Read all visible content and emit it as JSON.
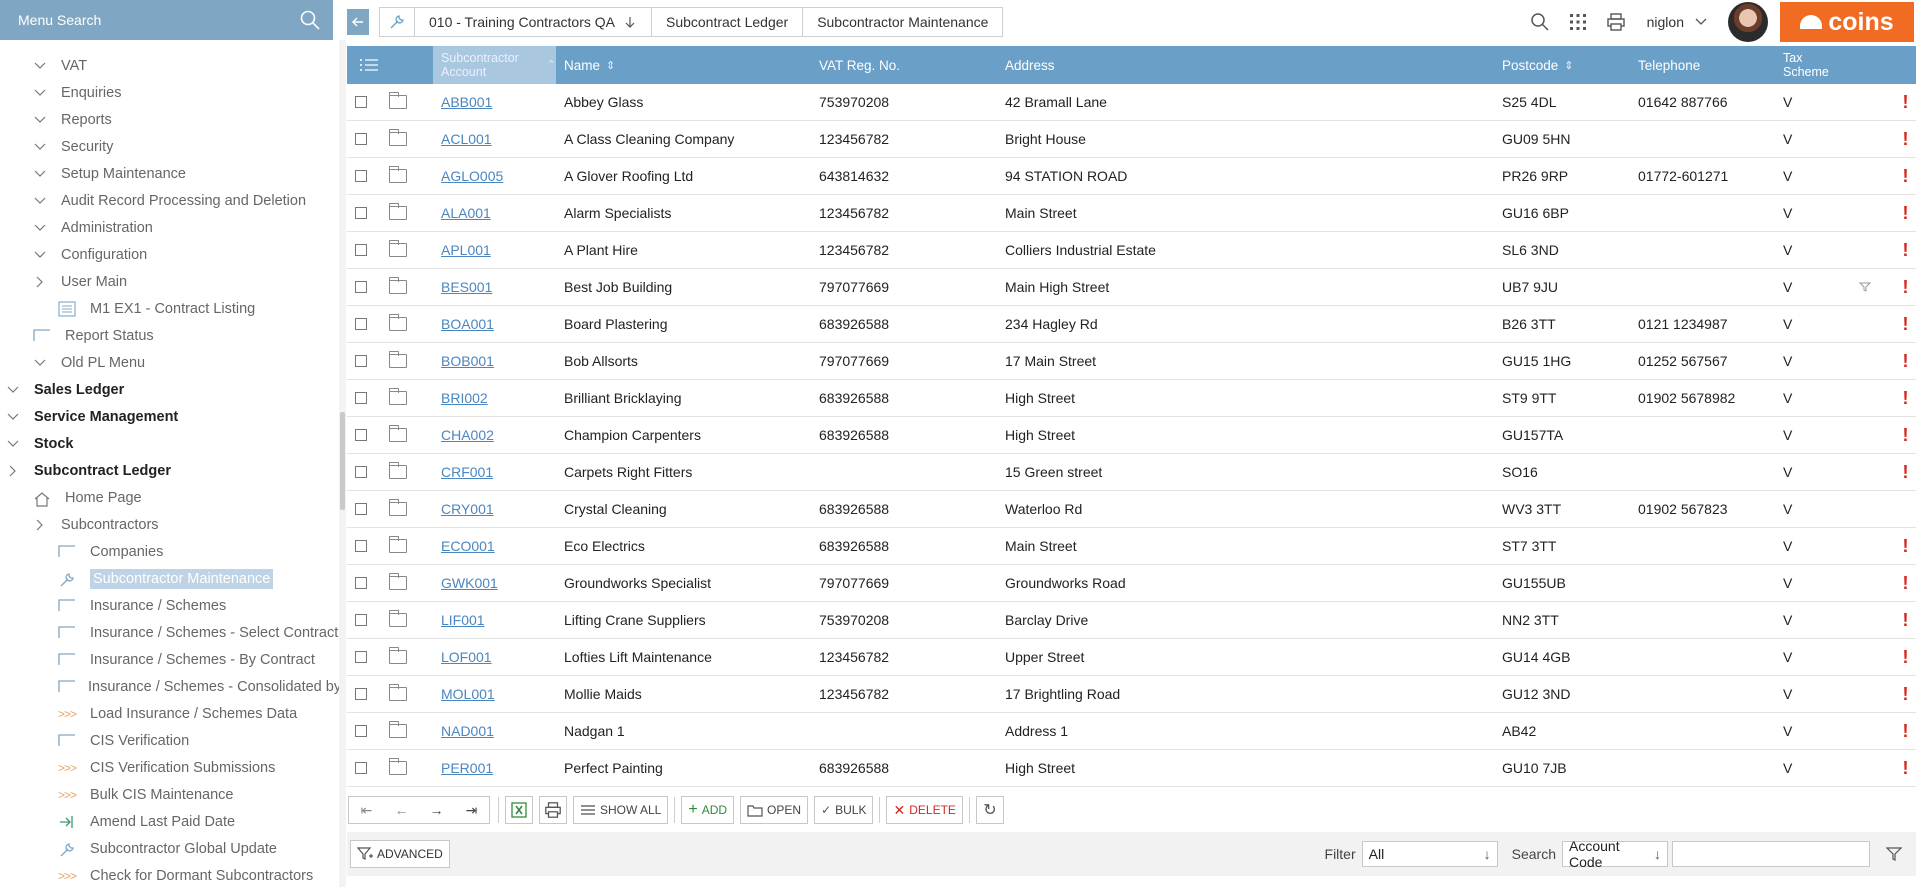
{
  "sidebar": {
    "search_label": "Menu Search",
    "items": [
      {
        "label": "VAT",
        "level": 1,
        "chev": "down",
        "icon": "",
        "style": "sub"
      },
      {
        "label": "Enquiries",
        "level": 1,
        "chev": "down",
        "icon": "",
        "style": "sub"
      },
      {
        "label": "Reports",
        "level": 1,
        "chev": "down",
        "icon": "",
        "style": "sub"
      },
      {
        "label": "Security",
        "level": 1,
        "chev": "down",
        "icon": "",
        "style": "sub"
      },
      {
        "label": "Setup Maintenance",
        "level": 1,
        "chev": "down",
        "icon": "",
        "style": "sub"
      },
      {
        "label": "Audit Record Processing and Deletion",
        "level": 1,
        "chev": "down",
        "icon": "",
        "style": "sub"
      },
      {
        "label": "Administration",
        "level": 1,
        "chev": "down",
        "icon": "",
        "style": "sub"
      },
      {
        "label": "Configuration",
        "level": 1,
        "chev": "down",
        "icon": "",
        "style": "sub"
      },
      {
        "label": "User Main",
        "level": 1,
        "chev": "right",
        "icon": "",
        "style": "sub"
      },
      {
        "label": "M1 EX1 - Contract Listing",
        "level": 2,
        "chev": "",
        "icon": "list",
        "style": "sub"
      },
      {
        "label": "Report Status",
        "level": 1,
        "chev": "",
        "icon": "screen",
        "style": "sub"
      },
      {
        "label": "Old PL Menu",
        "level": 1,
        "chev": "down",
        "icon": "",
        "style": "sub"
      },
      {
        "label": "Sales Ledger",
        "level": 0,
        "chev": "down",
        "icon": "",
        "style": "top"
      },
      {
        "label": "Service Management",
        "level": 0,
        "chev": "down",
        "icon": "",
        "style": "top"
      },
      {
        "label": "Stock",
        "level": 0,
        "chev": "down",
        "icon": "",
        "style": "top"
      },
      {
        "label": "Subcontract Ledger",
        "level": 0,
        "chev": "right",
        "icon": "",
        "style": "top"
      },
      {
        "label": "Home Page",
        "level": 1,
        "chev": "",
        "icon": "home",
        "style": "sub"
      },
      {
        "label": "Subcontractors",
        "level": 1,
        "chev": "right",
        "icon": "",
        "style": "sub"
      },
      {
        "label": "Companies",
        "level": 2,
        "chev": "",
        "icon": "screen",
        "style": "sub"
      },
      {
        "label": "Subcontractor Maintenance",
        "level": 2,
        "chev": "",
        "icon": "wrench",
        "style": "sel"
      },
      {
        "label": "Insurance / Schemes",
        "level": 2,
        "chev": "",
        "icon": "screen",
        "style": "sub"
      },
      {
        "label": "Insurance / Schemes - Select Contract",
        "level": 2,
        "chev": "",
        "icon": "screen",
        "style": "sub"
      },
      {
        "label": "Insurance / Schemes - By Contract",
        "level": 2,
        "chev": "",
        "icon": "screen",
        "style": "sub"
      },
      {
        "label": "Insurance / Schemes - Consolidated by",
        "level": 2,
        "chev": "",
        "icon": "screen",
        "style": "sub"
      },
      {
        "label": "Load Insurance / Schemes Data",
        "level": 2,
        "chev": "",
        "icon": "process",
        "style": "sub"
      },
      {
        "label": "CIS Verification",
        "level": 2,
        "chev": "",
        "icon": "screen",
        "style": "sub"
      },
      {
        "label": "CIS Verification Submissions",
        "level": 2,
        "chev": "",
        "icon": "process",
        "style": "sub"
      },
      {
        "label": "Bulk CIS Maintenance",
        "level": 2,
        "chev": "",
        "icon": "process",
        "style": "sub"
      },
      {
        "label": "Amend Last Paid Date",
        "level": 2,
        "chev": "",
        "icon": "arrow",
        "style": "sub"
      },
      {
        "label": "Subcontractor Global Update",
        "level": 2,
        "chev": "",
        "icon": "wrench",
        "style": "sub"
      },
      {
        "label": "Check for Dormant Subcontractors",
        "level": 2,
        "chev": "",
        "icon": "process",
        "style": "sub"
      }
    ]
  },
  "topbar": {
    "breadcrumbs": [
      "010 - Training Contractors QA",
      "Subcontract Ledger",
      "Subcontractor Maintenance"
    ],
    "username": "niglon",
    "logo_text": "coins"
  },
  "grid": {
    "columns": [
      "Subcontractor Account",
      "Name",
      "VAT Reg. No.",
      "Address",
      "Postcode",
      "Telephone",
      "Tax Scheme"
    ],
    "rows": [
      {
        "account": "ABB001",
        "name": "Abbey Glass",
        "vat": "753970208",
        "address": "42 Bramall Lane",
        "postcode": "S25 4DL",
        "telephone": "01642 887766",
        "tax": "V",
        "filter": false,
        "warn": true
      },
      {
        "account": "ACL001",
        "name": "A Class Cleaning Company",
        "vat": "123456782",
        "address": "Bright House",
        "postcode": "GU09 5HN",
        "telephone": "",
        "tax": "V",
        "filter": false,
        "warn": true
      },
      {
        "account": "AGLO005",
        "name": "A Glover Roofing Ltd",
        "vat": "643814632",
        "address": "94 STATION ROAD",
        "postcode": "PR26 9RP",
        "telephone": "01772-601271",
        "tax": "V",
        "filter": false,
        "warn": true
      },
      {
        "account": "ALA001",
        "name": "Alarm Specialists",
        "vat": "123456782",
        "address": "Main Street",
        "postcode": "GU16 6BP",
        "telephone": "",
        "tax": "V",
        "filter": false,
        "warn": true
      },
      {
        "account": "APL001",
        "name": "A Plant Hire",
        "vat": "123456782",
        "address": "Colliers Industrial Estate",
        "postcode": "SL6 3ND",
        "telephone": "",
        "tax": "V",
        "filter": false,
        "warn": true
      },
      {
        "account": "BES001",
        "name": "Best Job Building",
        "vat": "797077669",
        "address": "Main High Street",
        "postcode": "UB7 9JU",
        "telephone": "",
        "tax": "V",
        "filter": true,
        "warn": true
      },
      {
        "account": "BOA001",
        "name": "Board Plastering",
        "vat": "683926588",
        "address": "234 Hagley Rd",
        "postcode": "B26 3TT",
        "telephone": "0121 1234987",
        "tax": "V",
        "filter": false,
        "warn": true
      },
      {
        "account": "BOB001",
        "name": "Bob Allsorts",
        "vat": "797077669",
        "address": "17 Main Street",
        "postcode": "GU15 1HG",
        "telephone": "01252 567567",
        "tax": "V",
        "filter": false,
        "warn": true
      },
      {
        "account": "BRI002",
        "name": "Brilliant Bricklaying",
        "vat": "683926588",
        "address": "High Street",
        "postcode": "ST9 9TT",
        "telephone": "01902 5678982",
        "tax": "V",
        "filter": false,
        "warn": true
      },
      {
        "account": "CHA002",
        "name": "Champion Carpenters",
        "vat": "683926588",
        "address": "High Street",
        "postcode": "GU157TA",
        "telephone": "",
        "tax": "V",
        "filter": false,
        "warn": true
      },
      {
        "account": "CRF001",
        "name": "Carpets Right Fitters",
        "vat": "",
        "address": "15 Green street",
        "postcode": "SO16",
        "telephone": "",
        "tax": "V",
        "filter": false,
        "warn": true
      },
      {
        "account": "CRY001",
        "name": "Crystal Cleaning",
        "vat": "683926588",
        "address": "Waterloo Rd",
        "postcode": "WV3 3TT",
        "telephone": "01902 567823",
        "tax": "V",
        "filter": false,
        "warn": false
      },
      {
        "account": "ECO001",
        "name": "Eco Electrics",
        "vat": "683926588",
        "address": "Main Street",
        "postcode": "ST7 3TT",
        "telephone": "",
        "tax": "V",
        "filter": false,
        "warn": true
      },
      {
        "account": "GWK001",
        "name": "Groundworks Specialist",
        "vat": "797077669",
        "address": "Groundworks Road",
        "postcode": "GU155UB",
        "telephone": "",
        "tax": "V",
        "filter": false,
        "warn": true
      },
      {
        "account": "LIF001",
        "name": "Lifting Crane Suppliers",
        "vat": "753970208",
        "address": "Barclay Drive",
        "postcode": "NN2 3TT",
        "telephone": "",
        "tax": "V",
        "filter": false,
        "warn": true
      },
      {
        "account": "LOF001",
        "name": "Lofties Lift Maintenance",
        "vat": "123456782",
        "address": "Upper Street",
        "postcode": "GU14 4GB",
        "telephone": "",
        "tax": "V",
        "filter": false,
        "warn": true
      },
      {
        "account": "MOL001",
        "name": "Mollie Maids",
        "vat": "123456782",
        "address": "17 Brightling Road",
        "postcode": "GU12 3ND",
        "telephone": "",
        "tax": "V",
        "filter": false,
        "warn": true
      },
      {
        "account": "NAD001",
        "name": "Nadgan 1",
        "vat": "",
        "address": "Address 1",
        "postcode": "AB42",
        "telephone": "",
        "tax": "V",
        "filter": false,
        "warn": true
      },
      {
        "account": "PER001",
        "name": "Perfect Painting",
        "vat": "683926588",
        "address": "High Street",
        "postcode": "GU10 7JB",
        "telephone": "",
        "tax": "V",
        "filter": false,
        "warn": true
      }
    ]
  },
  "toolbar": {
    "show_all": "SHOW ALL",
    "add": "ADD",
    "open": "OPEN",
    "bulk": "BULK",
    "delete": "DELETE"
  },
  "filterbar": {
    "advanced": "ADVANCED",
    "filter_label": "Filter",
    "filter_value": "All",
    "search_label": "Search",
    "search_field": "Account Code",
    "search_value": ""
  },
  "colors": {
    "header_blue": "#6a9fc8",
    "menu_search_blue": "#7fa7c4",
    "link_blue": "#4a86c0",
    "warn_red": "#d7261e",
    "brand_orange": "#f26b22"
  }
}
